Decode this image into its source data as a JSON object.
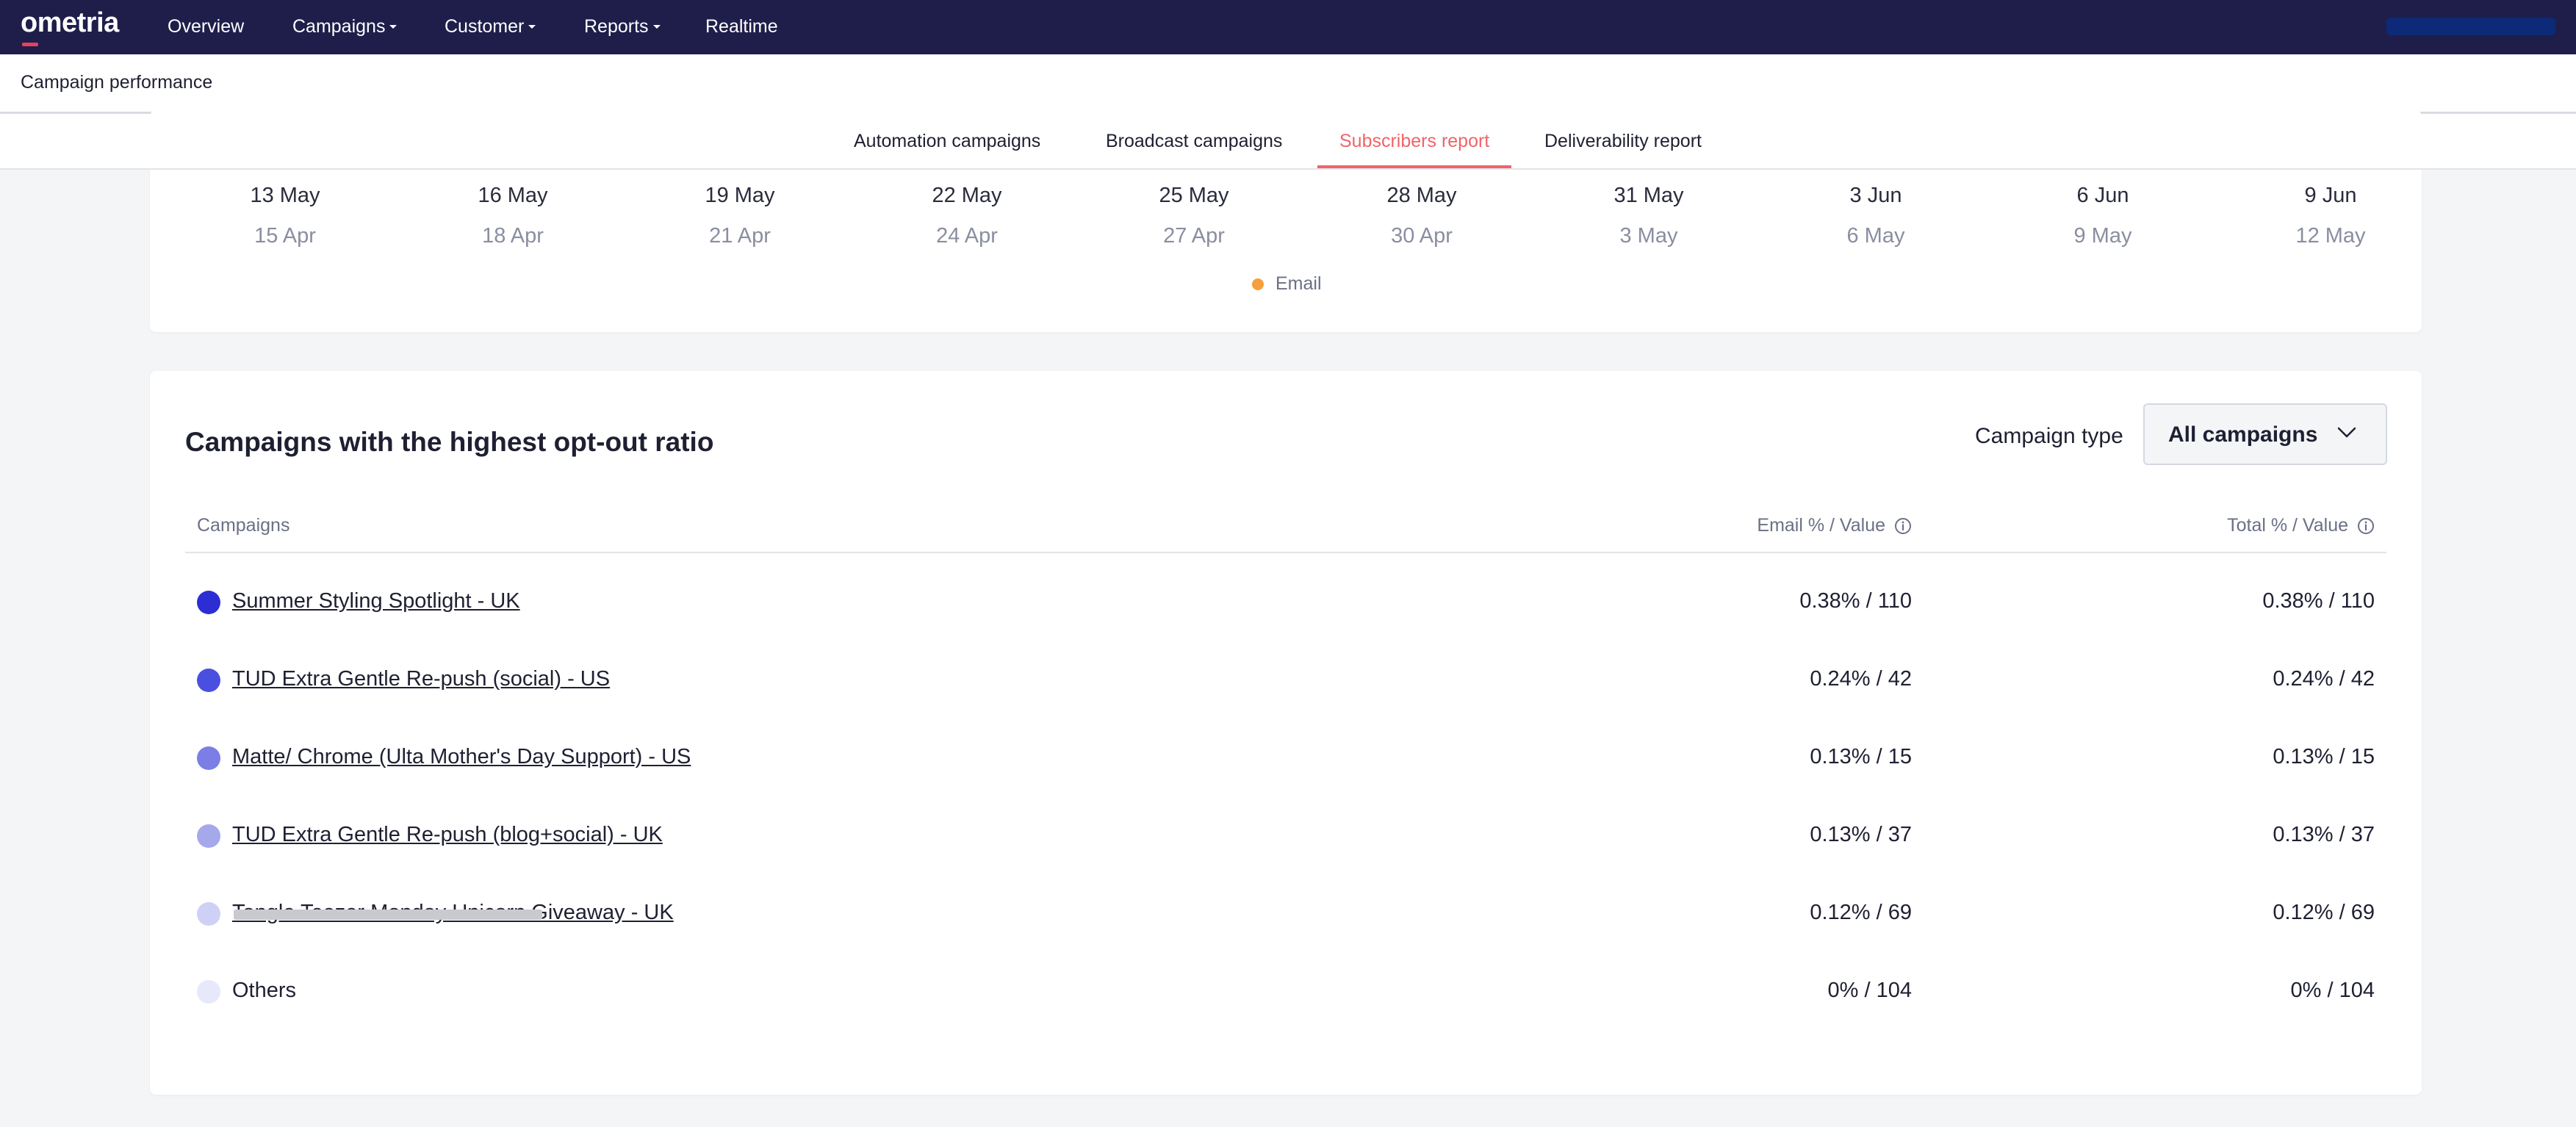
{
  "nav": {
    "logo": "ometria",
    "items": [
      {
        "label": "Overview",
        "dropdown": false
      },
      {
        "label": "Campaigns",
        "dropdown": true
      },
      {
        "label": "Customer",
        "dropdown": true
      },
      {
        "label": "Reports",
        "dropdown": true
      },
      {
        "label": "Realtime",
        "dropdown": false
      }
    ]
  },
  "page": {
    "title": "Campaign performance"
  },
  "tabs": [
    {
      "label": "Automation campaigns",
      "active": false
    },
    {
      "label": "Broadcast campaigns",
      "active": false
    },
    {
      "label": "Subscribers report",
      "active": true
    },
    {
      "label": "Deliverability report",
      "active": false
    }
  ],
  "chart": {
    "ticks_primary": [
      "13 May",
      "16 May",
      "19 May",
      "22 May",
      "25 May",
      "28 May",
      "31 May",
      "3 Jun",
      "6 Jun",
      "9 Jun"
    ],
    "ticks_secondary": [
      "15 Apr",
      "18 Apr",
      "21 Apr",
      "24 Apr",
      "27 Apr",
      "30 Apr",
      "3 May",
      "6 May",
      "9 May",
      "12 May"
    ],
    "legend": {
      "label": "Email",
      "color": "#f5a03a"
    }
  },
  "optout": {
    "title": "Campaigns with the highest opt-out ratio",
    "campaign_type_label": "Campaign type",
    "campaign_type_value": "All campaigns",
    "columns": {
      "campaigns": "Campaigns",
      "email": "Email % / Value",
      "total": "Total % / Value"
    },
    "rows": [
      {
        "name": "Summer Styling Spotlight - UK",
        "email": "0.38% / 110",
        "total": "0.38% / 110",
        "color": "#2c2ed3",
        "link": true
      },
      {
        "name": "TUD Extra Gentle Re-push (social) - US",
        "email": "0.24% / 42",
        "total": "0.24% / 42",
        "color": "#4b4fdf",
        "link": true
      },
      {
        "name": "Matte/ Chrome (Ulta Mother's Day Support) - US",
        "email": "0.13% / 15",
        "total": "0.13% / 15",
        "color": "#7b7ee4",
        "link": true
      },
      {
        "name": "TUD Extra Gentle Re-push (blog+social) - UK",
        "email": "0.13% / 37",
        "total": "0.13% / 37",
        "color": "#a6a8ec",
        "link": true
      },
      {
        "name": "Tangle Teezer Monday Unicorn Giveaway - UK",
        "email": "0.12% / 69",
        "total": "0.12% / 69",
        "color": "#cfd0f5",
        "link": true
      },
      {
        "name": "Others",
        "email": "0% / 104",
        "total": "0% / 104",
        "color": "#e7e8fa",
        "link": false
      }
    ]
  }
}
